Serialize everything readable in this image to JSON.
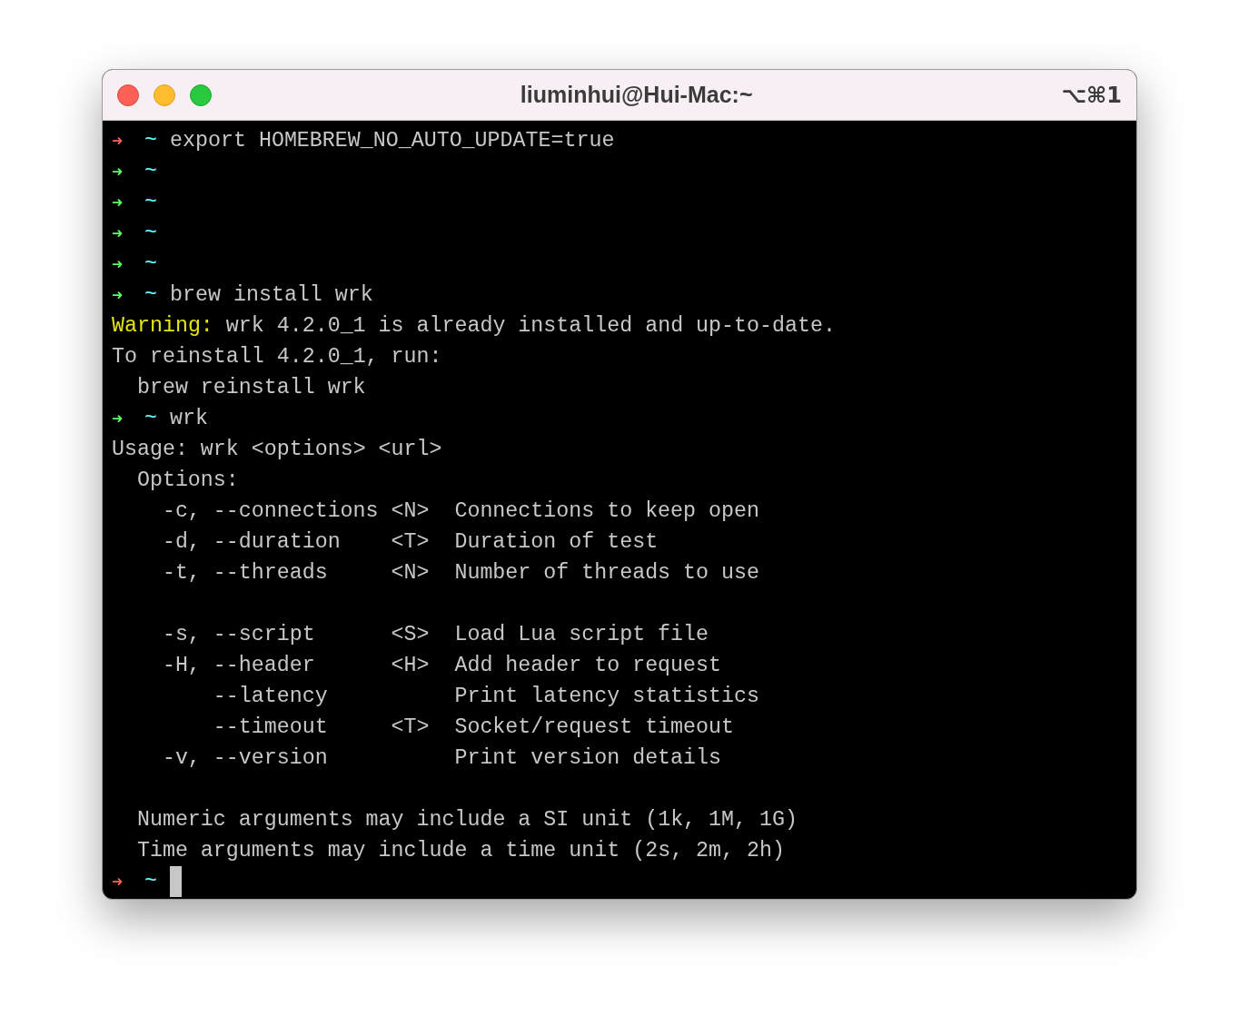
{
  "window": {
    "title": "liuminhui@Hui-Mac:~",
    "shortcut": "⌥⌘1"
  },
  "lines": [
    {
      "kind": "prompt",
      "arrow": "➜",
      "success": false,
      "dir": "~",
      "command": "export HOMEBREW_NO_AUTO_UPDATE=true",
      "cursor": false
    },
    {
      "kind": "prompt",
      "arrow": "➜",
      "success": true,
      "dir": "~",
      "cursor": false
    },
    {
      "kind": "prompt",
      "arrow": "➜",
      "success": true,
      "dir": "~",
      "cursor": false
    },
    {
      "kind": "prompt",
      "arrow": "➜",
      "success": true,
      "dir": "~",
      "cursor": false
    },
    {
      "kind": "prompt",
      "arrow": "➜",
      "success": true,
      "dir": "~",
      "cursor": false
    },
    {
      "kind": "prompt",
      "arrow": "➜",
      "success": true,
      "dir": "~",
      "command": "brew install wrk",
      "cursor": false
    },
    {
      "kind": "warning",
      "label": "Warning:",
      "text": "wrk 4.2.0_1 is already installed and up-to-date."
    },
    {
      "kind": "output",
      "text": "To reinstall 4.2.0_1, run:"
    },
    {
      "kind": "indented",
      "text": "brew reinstall wrk"
    },
    {
      "kind": "prompt",
      "arrow": "➜",
      "success": true,
      "dir": "~",
      "command": "wrk",
      "cursor": false
    },
    {
      "kind": "output",
      "text": "Usage: wrk <options> <url>"
    },
    {
      "kind": "indented",
      "text": "Options:"
    },
    {
      "kind": "option",
      "short": "-c,",
      "long": "--connections",
      "arg": "<N>",
      "desc": "Connections to keep open"
    },
    {
      "kind": "option",
      "short": "-d,",
      "long": "--duration",
      "arg": "<T>",
      "desc": "Duration of test"
    },
    {
      "kind": "option",
      "short": "-t,",
      "long": "--threads",
      "arg": "<N>",
      "desc": "Number of threads to use"
    },
    {
      "kind": "blank"
    },
    {
      "kind": "option",
      "short": "-s,",
      "long": "--script",
      "arg": "<S>",
      "desc": "Load Lua script file"
    },
    {
      "kind": "option",
      "short": "-H,",
      "long": "--header",
      "arg": "<H>",
      "desc": "Add header to request"
    },
    {
      "kind": "option",
      "long": "--latency",
      "desc": "Print latency statistics"
    },
    {
      "kind": "option",
      "long": "--timeout",
      "arg": "<T>",
      "desc": "Socket/request timeout"
    },
    {
      "kind": "option",
      "short": "-v,",
      "long": "--version",
      "desc": "Print version details"
    },
    {
      "kind": "blank"
    },
    {
      "kind": "indented",
      "text": "Numeric arguments may include a SI unit (1k, 1M, 1G)"
    },
    {
      "kind": "indented",
      "text": "Time arguments may include a time unit (2s, 2m, 2h)"
    },
    {
      "kind": "prompt",
      "arrow": "➜",
      "success": false,
      "dir": "~",
      "cursor": true
    }
  ]
}
